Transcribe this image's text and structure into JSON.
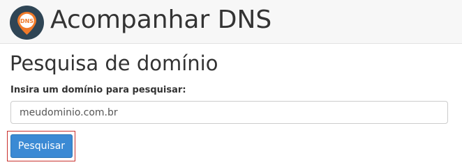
{
  "header": {
    "title": "Acompanhar DNS",
    "icon": "dns-location-pin-icon",
    "icon_badge_text": "DNS",
    "colors": {
      "icon_background": "#2f4555",
      "pin_orange": "#f07a2a"
    }
  },
  "main": {
    "section_title": "Pesquisa de domínio",
    "field_label": "Insira um domínio para pesquisar:",
    "domain_input": {
      "value": "meudominio.com.br",
      "placeholder": ""
    },
    "search_button_label": "Pesquisar",
    "colors": {
      "button": "#3b8ad4",
      "focus_ring": "#c9302c"
    }
  }
}
